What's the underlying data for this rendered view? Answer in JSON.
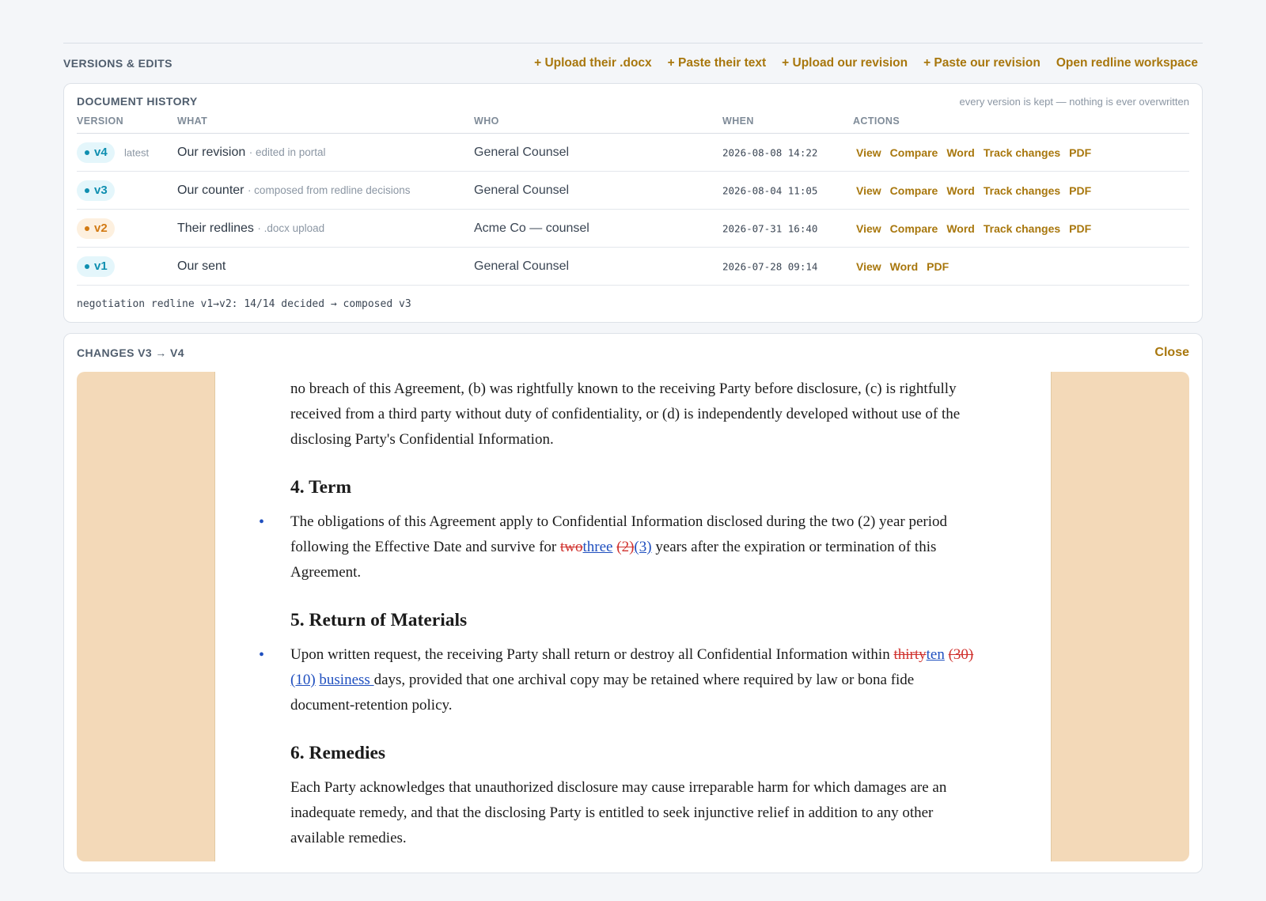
{
  "section": {
    "title": "VERSIONS & EDITS",
    "actions": [
      "+ Upload their .docx",
      "+ Paste their text",
      "+ Upload our revision",
      "+ Paste our revision",
      "Open redline workspace"
    ]
  },
  "history": {
    "title": "DOCUMENT HISTORY",
    "note": "every version is kept — nothing is ever overwritten",
    "columns": [
      "VERSION",
      "WHAT",
      "WHO",
      "WHEN",
      "ACTIONS"
    ],
    "rows": [
      {
        "version": "v4",
        "latest": "latest",
        "what": "Our revision",
        "sub": "· edited in portal",
        "who": "General Counsel",
        "when": "2026-08-08 14:22",
        "color": "#0f8fb0",
        "actions": [
          "View",
          "Compare",
          "Word",
          "Track changes",
          "PDF"
        ]
      },
      {
        "version": "v3",
        "latest": "",
        "what": "Our counter",
        "sub": "· composed from redline decisions",
        "who": "General Counsel",
        "when": "2026-08-04 11:05",
        "color": "#0f8fb0",
        "actions": [
          "View",
          "Compare",
          "Word",
          "Track changes",
          "PDF"
        ]
      },
      {
        "version": "v2",
        "latest": "",
        "what": "Their redlines",
        "sub": "· .docx upload",
        "who": "Acme Co — counsel",
        "when": "2026-07-31 16:40",
        "color": "#d27a13",
        "actions": [
          "View",
          "Compare",
          "Word",
          "Track changes",
          "PDF"
        ]
      },
      {
        "version": "v1",
        "latest": "",
        "what": "Our sent",
        "sub": "",
        "who": "General Counsel",
        "when": "2026-07-28 09:14",
        "color": "#0f8fb0",
        "actions": [
          "View",
          "Word",
          "PDF"
        ]
      }
    ],
    "footnote": "negotiation redline v1→v2: 14/14 decided → composed v3"
  },
  "changes": {
    "title": "CHANGES V3 → V4",
    "close_label": "Close",
    "doc": {
      "p_top": "no breach of this Agreement, (b) was rightfully known to the receiving Party before disclosure, (c) is rightfully received from a third party without duty of confidentiality, or (d) is independently developed without use of the disclosing Party's Confidential Information.",
      "h_term": "4. Term",
      "term_a": "The obligations of this Agreement apply to Confidential Information disclosed during the two (2) year period following the Effective Date and survive for ",
      "term_del1": "two",
      "term_ins1": "three",
      "term_del2": "(2)",
      "term_ins2": "(3)",
      "term_b": " years after the expiration or termination of this Agreement.",
      "h_return": "5. Return of Materials",
      "ret_a": "Upon written request, the receiving Party shall return or destroy all Confidential Information within ",
      "ret_del1": "thirty",
      "ret_ins1": "ten",
      "ret_del2": "(30)",
      "ret_ins2": "(10)",
      "ret_ins3": "business ",
      "ret_b": "days, provided that one archival copy may be retained where required by law or bona fide document-retention policy.",
      "h_remedies": "6. Remedies",
      "rem": "Each Party acknowledges that unauthorized disclosure may cause irreparable harm for which damages are an inadequate remedy, and that the disclosing Party is entitled to seek injunctive relief in addition to any other available remedies."
    }
  }
}
